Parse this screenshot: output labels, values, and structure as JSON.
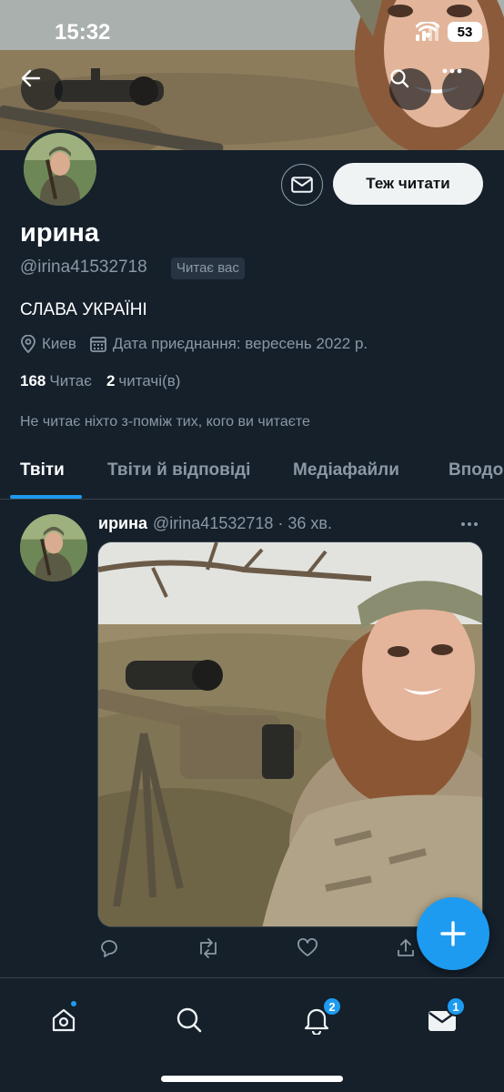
{
  "status_bar": {
    "time": "15:32",
    "battery": "53"
  },
  "profile": {
    "display_name": "ирина",
    "handle": "@irina41532718",
    "follows_you": "Читає вас",
    "bio": "СЛАВА УКРАЇНІ",
    "location": "Киев",
    "joined": "Дата приєднання: вересень 2022 р.",
    "following_count": "168",
    "following_label": "Читає",
    "followers_count": "2",
    "followers_label": "читачі(в)",
    "mutuals_note": "Не читає ніхто з-поміж тих, кого ви читаєте",
    "follow_button": "Теж читати"
  },
  "tabs": [
    {
      "label": "Твіти",
      "active": true
    },
    {
      "label": "Твіти й відповіді",
      "active": false
    },
    {
      "label": "Медіафайли",
      "active": false
    },
    {
      "label": "Вподо",
      "active": false
    }
  ],
  "tweet": {
    "name": "ирина",
    "handle": "@irina41532718",
    "time": "· 36 хв."
  },
  "bottom_nav": {
    "notifications_badge": "2",
    "messages_badge": "1"
  },
  "icons": {
    "back": "back-arrow-icon",
    "search": "search-icon",
    "more": "more-icon",
    "mail": "envelope-icon",
    "location": "location-pin-icon",
    "calendar": "calendar-icon",
    "reply": "reply-icon",
    "retweet": "retweet-icon",
    "like": "heart-icon",
    "share": "share-icon",
    "compose": "plus-icon",
    "home": "home-icon",
    "explore": "search-icon",
    "notifications": "bell-icon",
    "messages": "envelope-icon"
  },
  "colors": {
    "background": "#15202b",
    "accent": "#1d9bf0",
    "secondary_text": "#8b98a5",
    "divider": "#38444d"
  }
}
